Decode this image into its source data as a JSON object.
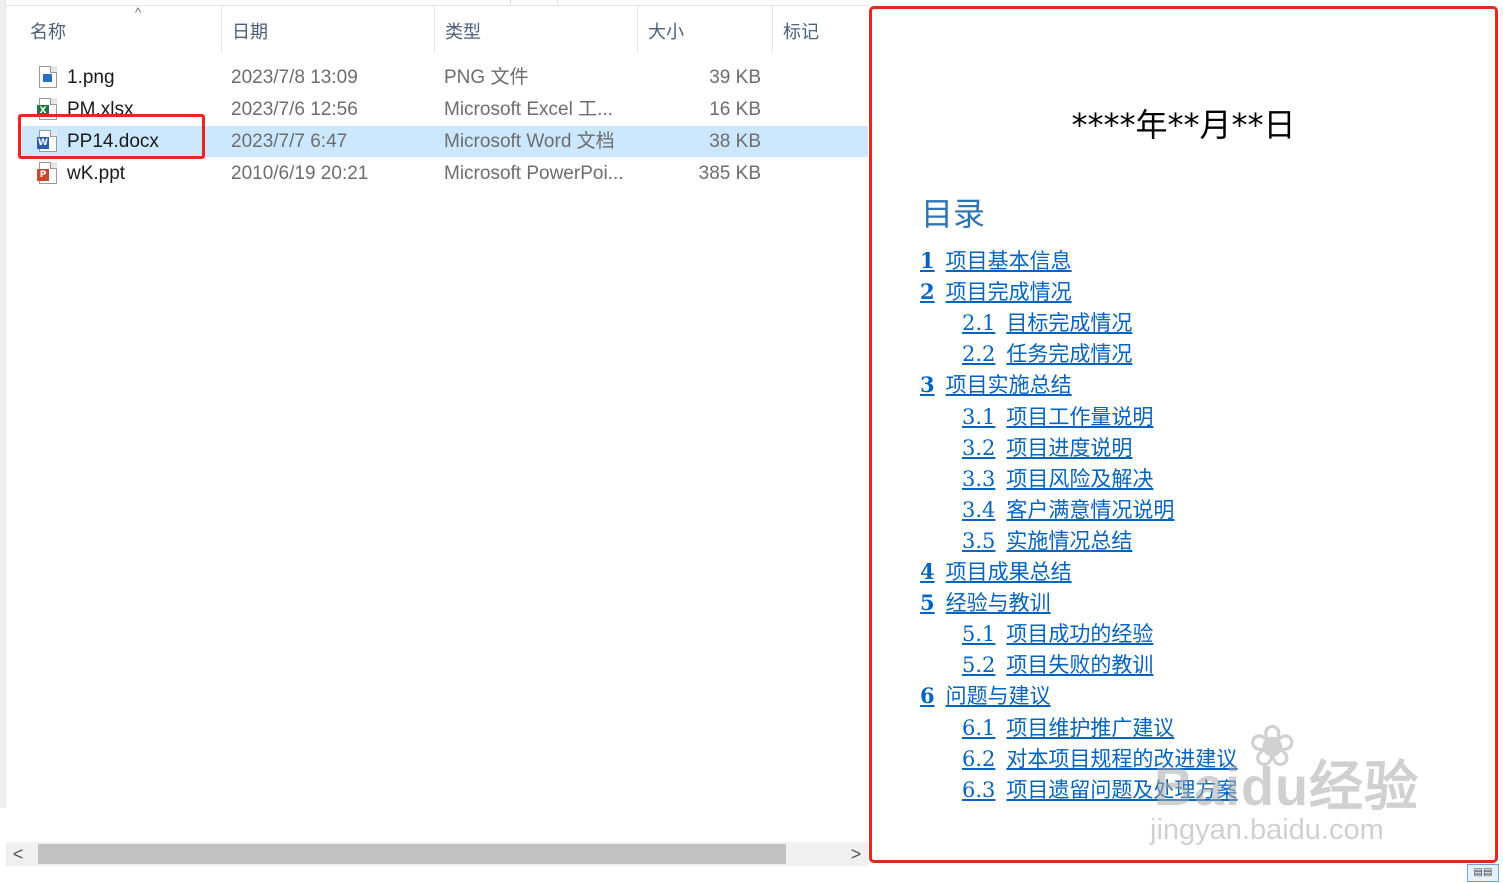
{
  "columns": [
    {
      "label": "名称"
    },
    {
      "label": "日期"
    },
    {
      "label": "类型"
    },
    {
      "label": "大小"
    },
    {
      "label": "标记"
    }
  ],
  "sort_arrow": "^",
  "files": [
    {
      "name": "1.png",
      "date": "2023/7/8 13:09",
      "type": "PNG 文件",
      "size": "39 KB",
      "icon": "png-file-icon",
      "selected": false
    },
    {
      "name": "PM.xlsx",
      "date": "2023/7/6 12:56",
      "type": "Microsoft Excel 工...",
      "size": "16 KB",
      "icon": "excel-file-icon",
      "selected": false
    },
    {
      "name": "PP14.docx",
      "date": "2023/7/7 6:47",
      "type": "Microsoft Word 文档",
      "size": "38 KB",
      "icon": "word-file-icon",
      "selected": true
    },
    {
      "name": "wK.ppt",
      "date": "2010/6/19 20:21",
      "type": "Microsoft PowerPoi...",
      "size": "385 KB",
      "icon": "powerpoint-file-icon",
      "selected": false
    }
  ],
  "scrollbar": {
    "left_arrow": "<",
    "right_arrow": ">"
  },
  "preview": {
    "date_line": "****年**月**日",
    "toc_title": "目录",
    "toc": [
      {
        "num": "1",
        "text": "项目基本信息",
        "level": 1
      },
      {
        "num": "2",
        "text": "项目完成情况",
        "level": 1
      },
      {
        "num": "2.1",
        "text": "目标完成情况",
        "level": 2
      },
      {
        "num": "2.2",
        "text": "任务完成情况",
        "level": 2
      },
      {
        "num": "3",
        "text": "项目实施总结",
        "level": 1
      },
      {
        "num": "3.1",
        "text": "项目工作量说明",
        "level": 2
      },
      {
        "num": "3.2",
        "text": "项目进度说明",
        "level": 2
      },
      {
        "num": "3.3",
        "text": "项目风险及解决",
        "level": 2
      },
      {
        "num": "3.4",
        "text": "客户满意情况说明",
        "level": 2
      },
      {
        "num": "3.5",
        "text": "实施情况总结",
        "level": 2
      },
      {
        "num": "4",
        "text": "项目成果总结",
        "level": 1
      },
      {
        "num": "5",
        "text": "经验与教训",
        "level": 1
      },
      {
        "num": "5.1",
        "text": "项目成功的经验",
        "level": 2
      },
      {
        "num": "5.2",
        "text": "项目失败的教训",
        "level": 2
      },
      {
        "num": "6",
        "text": "问题与建议",
        "level": 1
      },
      {
        "num": "6.1",
        "text": "项目维护推广建议",
        "level": 2
      },
      {
        "num": "6.2",
        "text": "对本项目规程的改进建议",
        "level": 2
      },
      {
        "num": "6.3",
        "text": "项目遗留问题及处理方案",
        "level": 2
      }
    ]
  },
  "watermark": {
    "logo": "Baidu经验",
    "site": "jingyan.baidu.com"
  },
  "colors": {
    "highlight": "#e5271e",
    "selection": "#cce8ff",
    "link": "#0563c1",
    "toc_heading": "#2e74b5"
  }
}
